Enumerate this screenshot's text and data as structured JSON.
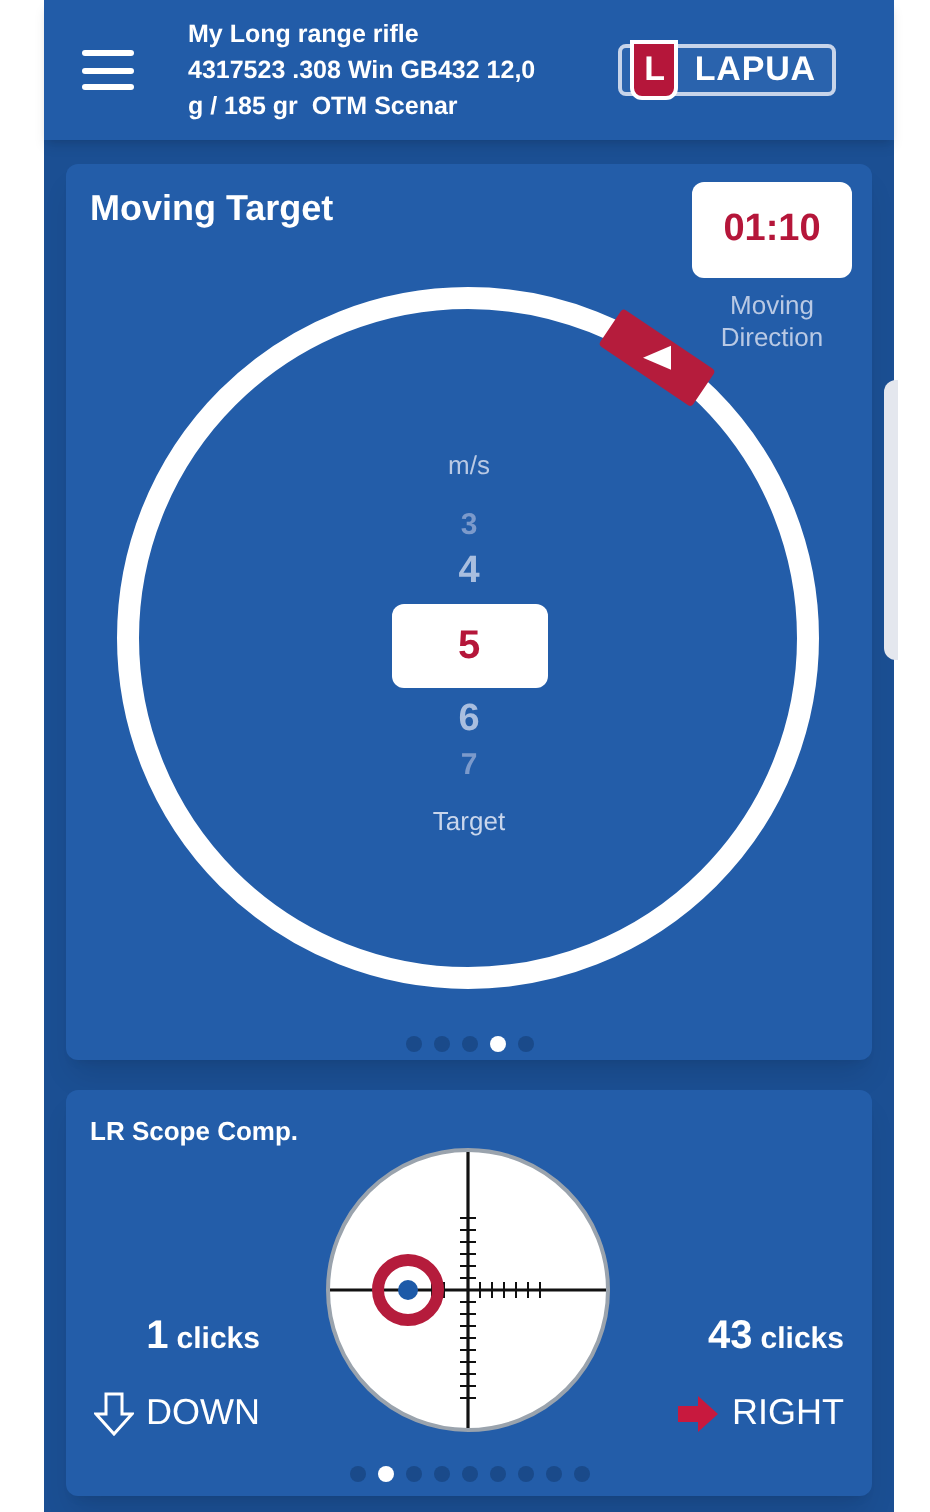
{
  "header": {
    "rifle_lines": [
      "My Long range rifle",
      "4317523 .308 Win GB432 12,0",
      "g / 185 gr  OTM Scenar"
    ],
    "logo": {
      "badge": "L",
      "text": "LAPUA"
    }
  },
  "moving_target": {
    "title": "Moving Target",
    "timer": "01:10",
    "timer_label": "Moving Direction",
    "unit": "m/s",
    "speeds": [
      {
        "value": "3",
        "selected": false
      },
      {
        "value": "4",
        "selected": false
      },
      {
        "value": "5",
        "selected": true
      },
      {
        "value": "6",
        "selected": false
      },
      {
        "value": "7",
        "selected": false
      }
    ],
    "speed_label": "Target",
    "pager": [
      {
        "selected": false
      },
      {
        "selected": false
      },
      {
        "selected": false
      },
      {
        "selected": true
      },
      {
        "selected": false
      }
    ]
  },
  "scope_comp": {
    "title": "LR Scope Comp.",
    "corrections": [
      {
        "kind": "down",
        "value": "1",
        "unit": "clicks",
        "direction": "DOWN"
      },
      {
        "kind": "right",
        "value": "43",
        "unit": "clicks",
        "direction": "RIGHT"
      }
    ],
    "pager": [
      {
        "selected": false
      },
      {
        "selected": true
      },
      {
        "selected": false
      },
      {
        "selected": false
      },
      {
        "selected": false
      },
      {
        "selected": false
      },
      {
        "selected": false
      },
      {
        "selected": false
      },
      {
        "selected": false
      }
    ]
  }
}
